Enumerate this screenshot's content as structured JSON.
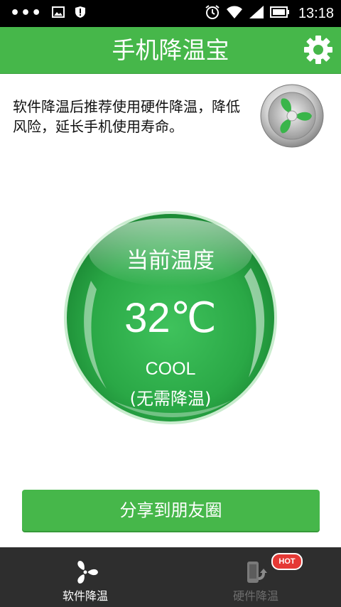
{
  "status_bar": {
    "time": "13:18",
    "icons": [
      "more-dots-icon",
      "image-icon",
      "shield-icon",
      "alarm-icon",
      "wifi-icon",
      "signal-icon",
      "battery-icon"
    ]
  },
  "header": {
    "title": "手机降温宝",
    "settings_icon": "gear-icon"
  },
  "tip": {
    "text": "软件降温后推荐使用硬件降温，降低风险，延长手机使用寿命。",
    "fan_icon": "fan-icon"
  },
  "temperature": {
    "label": "当前温度",
    "value": "32℃",
    "status": "COOL",
    "advice": "(无需降温)"
  },
  "share": {
    "label": "分享到朋友圈"
  },
  "bottom_nav": {
    "tabs": [
      {
        "label": "软件降温",
        "icon": "fan-icon",
        "active": true
      },
      {
        "label": "硬件降温",
        "icon": "phone-cooler-icon",
        "active": false,
        "badge": "HOT"
      }
    ]
  },
  "colors": {
    "brand_green": "#46b74a",
    "orb_green": "#2fae4a",
    "nav_bg": "#2e2e2e",
    "badge_red": "#e53935"
  }
}
